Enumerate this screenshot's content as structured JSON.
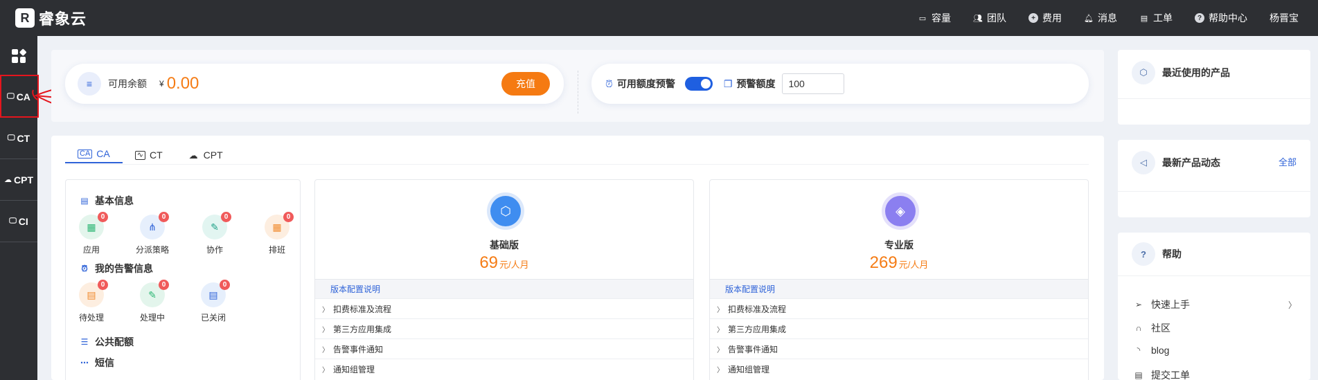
{
  "header": {
    "logo_mark": "R",
    "logo_text": "睿象云",
    "nav": [
      {
        "label": "容量",
        "icon": "inbox-icon"
      },
      {
        "label": "团队",
        "icon": "team-icon"
      },
      {
        "label": "费用",
        "icon": "fee-icon"
      },
      {
        "label": "消息",
        "icon": "bell-icon"
      },
      {
        "label": "工单",
        "icon": "clipboard-icon"
      },
      {
        "label": "帮助中心",
        "icon": "help-icon"
      }
    ],
    "user": "杨晋宝"
  },
  "rail": {
    "items": [
      {
        "label": "CA",
        "icon": "monitor-icon"
      },
      {
        "label": "CT",
        "icon": "chart-monitor-icon"
      },
      {
        "label": "CPT",
        "icon": "cloud-icon"
      },
      {
        "label": "CI",
        "icon": "monitor-icon"
      }
    ]
  },
  "balance": {
    "label": "可用余额",
    "currency": "¥",
    "amount": "0.00",
    "recharge_label": "充值",
    "warn_label": "可用额度预警",
    "warn_enabled": true,
    "threshold_label": "预警额度",
    "threshold_value": "100"
  },
  "tabs": [
    {
      "label": "CA",
      "icon": "monitor-icon",
      "active": true
    },
    {
      "label": "CT",
      "icon": "chart-monitor-icon",
      "active": false
    },
    {
      "label": "CPT",
      "icon": "cloud-icon",
      "active": false
    }
  ],
  "basic_info": {
    "title": "基本信息",
    "stats": [
      {
        "label": "应用",
        "count": "0",
        "icon": "apps-icon"
      },
      {
        "label": "分派策略",
        "count": "0",
        "icon": "dispatch-icon"
      },
      {
        "label": "协作",
        "count": "0",
        "icon": "collab-icon"
      },
      {
        "label": "排班",
        "count": "0",
        "icon": "calendar-icon"
      }
    ]
  },
  "alerts": {
    "title": "我的告警信息",
    "stats": [
      {
        "label": "待处理",
        "count": "0",
        "icon": "pending-icon"
      },
      {
        "label": "处理中",
        "count": "0",
        "icon": "processing-icon"
      },
      {
        "label": "已关闭",
        "count": "0",
        "icon": "closed-icon"
      }
    ]
  },
  "public_config": {
    "title": "公共配额"
  },
  "sms": {
    "title": "短信"
  },
  "plans": [
    {
      "name": "基础版",
      "price": "69",
      "unit": "元/人月",
      "spec_label": "版本配置说明",
      "rows": [
        "扣费标准及流程",
        "第三方应用集成",
        "告警事件通知",
        "通知组管理"
      ]
    },
    {
      "name": "专业版",
      "price": "269",
      "unit": "元/人月",
      "spec_label": "版本配置说明",
      "rows": [
        "扣费标准及流程",
        "第三方应用集成",
        "告警事件通知",
        "通知组管理"
      ]
    }
  ],
  "right": {
    "recent_title": "最近使用的产品",
    "news_title": "最新产品动态",
    "news_more": "全部",
    "help_title": "帮助",
    "help_items": [
      {
        "label": "快速上手",
        "icon": "paper-plane-icon",
        "arrow": true
      },
      {
        "label": "社区",
        "icon": "headset-icon",
        "arrow": false
      },
      {
        "label": "blog",
        "icon": "rss-icon",
        "arrow": false
      },
      {
        "label": "提交工单",
        "icon": "ticket-icon",
        "arrow": false
      }
    ]
  },
  "colors": {
    "topbar": "#2d2f33",
    "accent": "#2f63d8",
    "orange": "#f57a12",
    "annotation_red": "#e5151d"
  }
}
